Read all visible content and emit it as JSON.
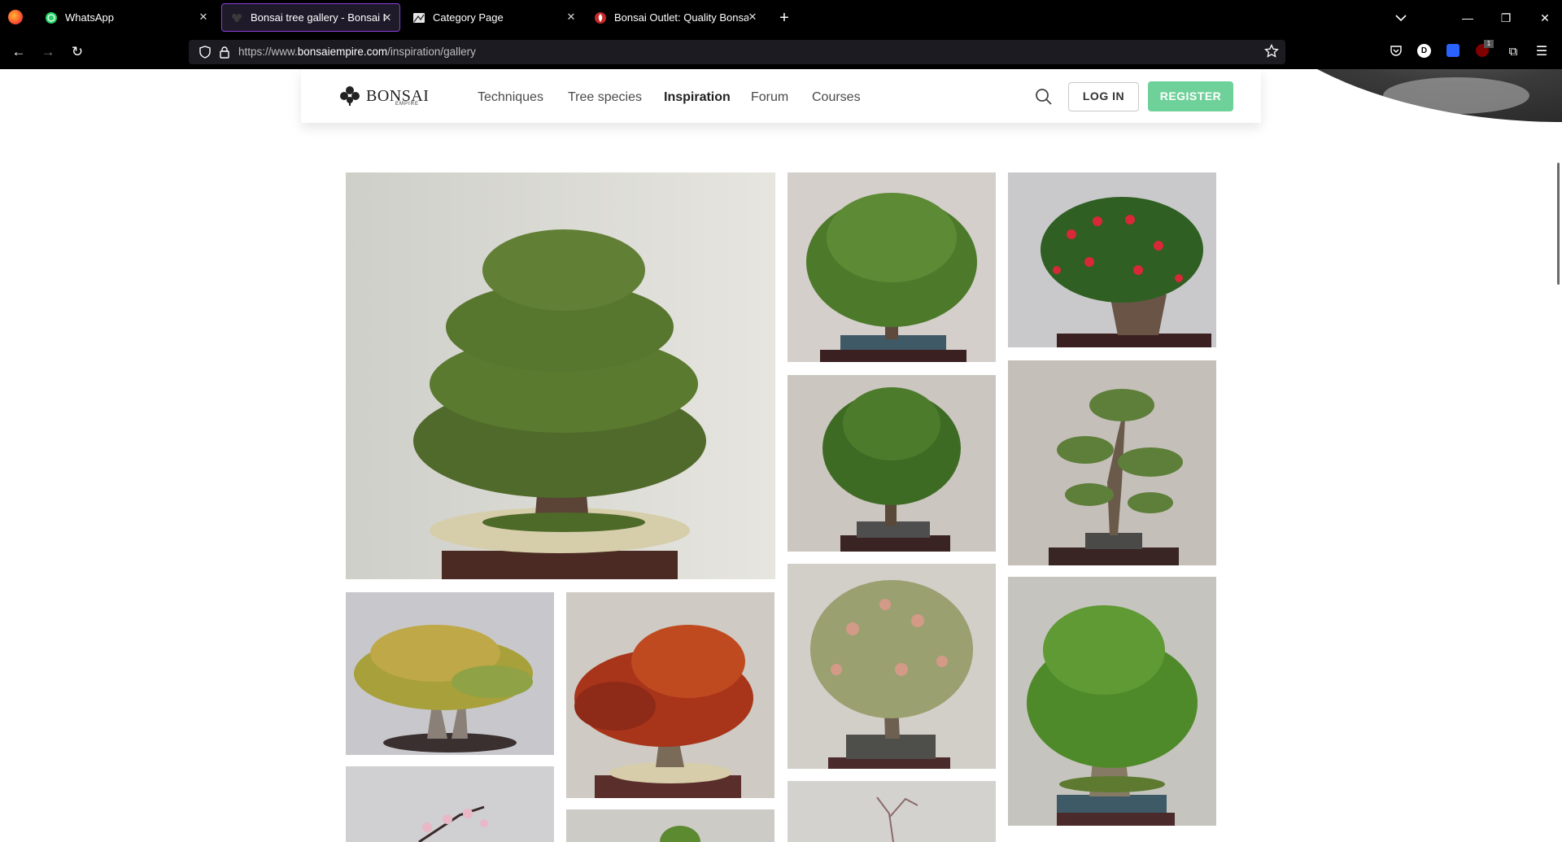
{
  "tabs": [
    {
      "title": "WhatsApp",
      "icon": "whatsapp-icon",
      "active": false
    },
    {
      "title": "Bonsai tree gallery - Bonsai Emp",
      "icon": "bonsai-empire-icon",
      "active": true
    },
    {
      "title": "Category Page",
      "icon": "category-page-icon",
      "active": false
    },
    {
      "title": "Bonsai Outlet: Quality Bonsai Tr",
      "icon": "bonsai-outlet-icon",
      "active": false
    }
  ],
  "address_bar": {
    "prefix": "https://www.",
    "host": "bonsaiempire.com",
    "path": "/inspiration/gallery"
  },
  "site": {
    "logo_text": "BONSAI",
    "logo_subtext": "EMPIRE",
    "menu": [
      "Techniques",
      "Tree species",
      "Inspiration",
      "Forum",
      "Courses"
    ],
    "active_menu": "Inspiration",
    "login_label": "LOG IN",
    "register_label": "REGISTER"
  },
  "gallery": {
    "photos": [
      {
        "name": "juniper-large"
      },
      {
        "name": "broadleaf-round"
      },
      {
        "name": "camellia-red-flowers"
      },
      {
        "name": "dense-broadleaf"
      },
      {
        "name": "slender-juniper"
      },
      {
        "name": "yellow-maple"
      },
      {
        "name": "red-maple"
      },
      {
        "name": "pink-flowering"
      },
      {
        "name": "tall-broadleaf"
      },
      {
        "name": "pink-blossom-partial"
      },
      {
        "name": "green-partial"
      },
      {
        "name": "bare-partial"
      }
    ]
  },
  "colors": {
    "accent_register": "#6fd19a",
    "active_tab_border": "#8a3fdb",
    "chrome_bg": "#000000"
  }
}
